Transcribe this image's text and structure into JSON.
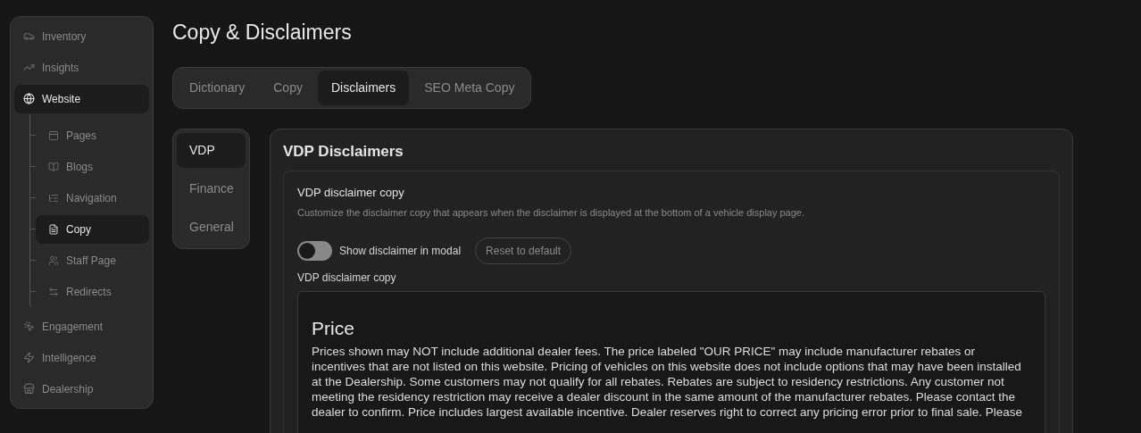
{
  "sidebar": {
    "items": [
      {
        "label": "Inventory",
        "selected": false
      },
      {
        "label": "Insights",
        "selected": false
      },
      {
        "label": "Website",
        "selected": true,
        "children": [
          {
            "label": "Pages",
            "selected": false
          },
          {
            "label": "Blogs",
            "selected": false
          },
          {
            "label": "Navigation",
            "selected": false
          },
          {
            "label": "Copy",
            "selected": true
          },
          {
            "label": "Staff Page",
            "selected": false
          },
          {
            "label": "Redirects",
            "selected": false
          }
        ]
      },
      {
        "label": "Engagement",
        "selected": false
      },
      {
        "label": "Intelligence",
        "selected": false
      },
      {
        "label": "Dealership",
        "selected": false
      }
    ]
  },
  "page_title": "Copy & Disclaimers",
  "tabs": [
    {
      "label": "Dictionary",
      "selected": false
    },
    {
      "label": "Copy",
      "selected": false
    },
    {
      "label": "Disclaimers",
      "selected": true
    },
    {
      "label": "SEO Meta Copy",
      "selected": false
    }
  ],
  "subnav": [
    {
      "label": "VDP",
      "selected": true
    },
    {
      "label": "Finance",
      "selected": false
    },
    {
      "label": "General",
      "selected": false
    }
  ],
  "panel": {
    "title": "VDP Disclaimers",
    "section": {
      "title": "VDP disclaimer copy",
      "description": "Customize the disclaimer copy that appears when the disclaimer is displayed at the bottom of a vehicle display page.",
      "toggle": {
        "label": "Show disclaimer in modal",
        "on": false
      },
      "reset_button": "Reset to default",
      "field_label": "VDP disclaimer copy",
      "editor": {
        "heading": "Price",
        "body": "Prices shown may NOT include additional dealer fees. The price labeled \"OUR PRICE\" may include manufacturer rebates or incentives that are not listed on this website. Pricing of vehicles on this website does not include options that may have been installed at the Dealership. Some customers may not qualify for all rebates. Rebates are subject to residency restrictions. Any customer not meeting the residency restriction may receive a dealer discount in the same amount of the manufacturer rebates. Please contact the dealer to confirm. Price includes largest available incentive. Dealer reserves right to correct any pricing error prior to final sale. Please"
      }
    }
  }
}
